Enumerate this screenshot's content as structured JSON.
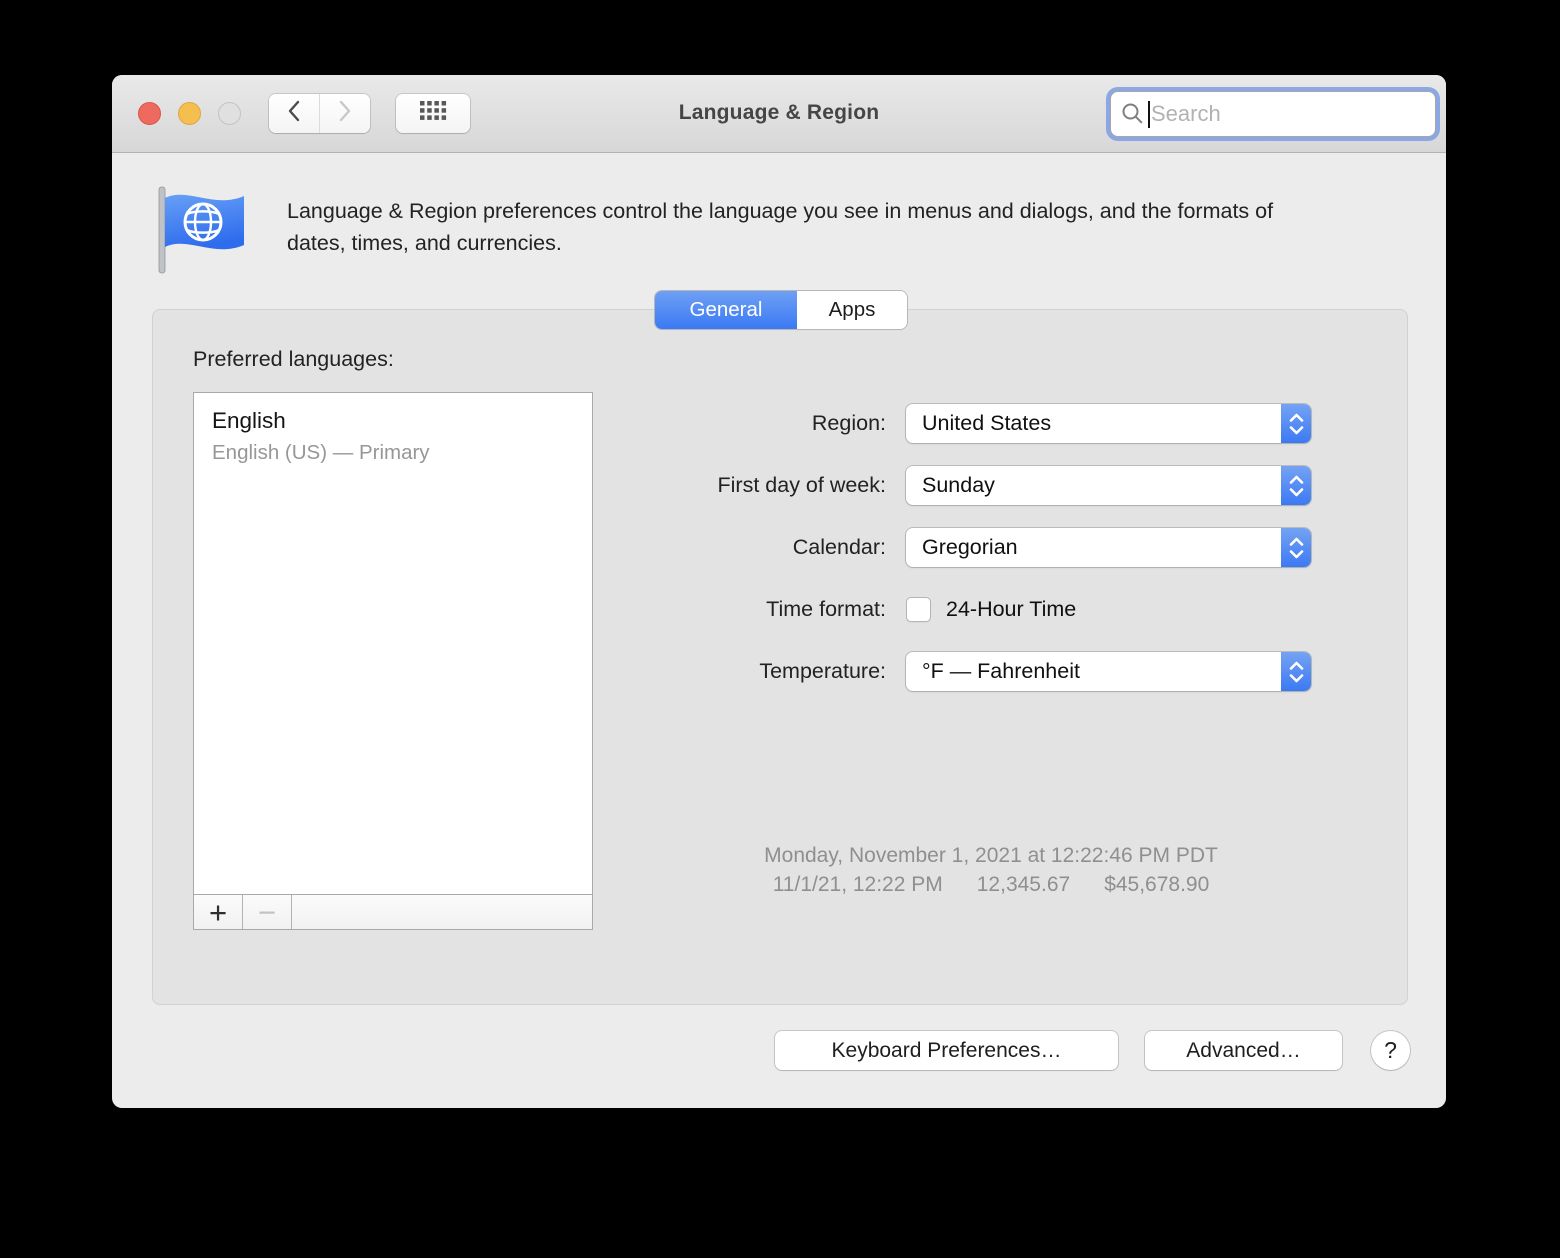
{
  "window": {
    "title": "Language & Region",
    "search": {
      "placeholder": "Search"
    }
  },
  "header": {
    "description": "Language & Region preferences control the language you see in menus and dialogs, and the formats of dates, times, and currencies."
  },
  "tabs": [
    {
      "label": "General",
      "selected": true
    },
    {
      "label": "Apps",
      "selected": false
    }
  ],
  "general": {
    "preferred_languages": {
      "label": "Preferred languages:",
      "items": [
        {
          "language": "English",
          "detail": "English (US) — Primary"
        }
      ],
      "add_button": "+",
      "remove_button": "−"
    },
    "fields": {
      "region": {
        "label": "Region:",
        "value": "United States"
      },
      "first_day_of_week": {
        "label": "First day of week:",
        "value": "Sunday"
      },
      "calendar": {
        "label": "Calendar:",
        "value": "Gregorian"
      },
      "time_format": {
        "label": "Time format:",
        "option": "24-Hour Time",
        "checked": false
      },
      "temperature": {
        "label": "Temperature:",
        "value": "°F — Fahrenheit"
      }
    },
    "preview": {
      "full_date": "Monday, November 1, 2021 at 12:22:46 PM PDT",
      "short_date": "11/1/21, 12:22 PM",
      "number": "12,345.67",
      "currency": "$45,678.90"
    }
  },
  "footer": {
    "keyboard_preferences_button": "Keyboard Preferences…",
    "advanced_button": "Advanced…",
    "help_button": "?"
  },
  "colors": {
    "accent_blue": "#3b79f4",
    "traffic_red": "#ee6a5f",
    "traffic_yellow": "#f5bf4f",
    "window_bg": "#ececec",
    "panel_bg": "#e3e3e3",
    "focus_ring": "#7d9ee4"
  }
}
